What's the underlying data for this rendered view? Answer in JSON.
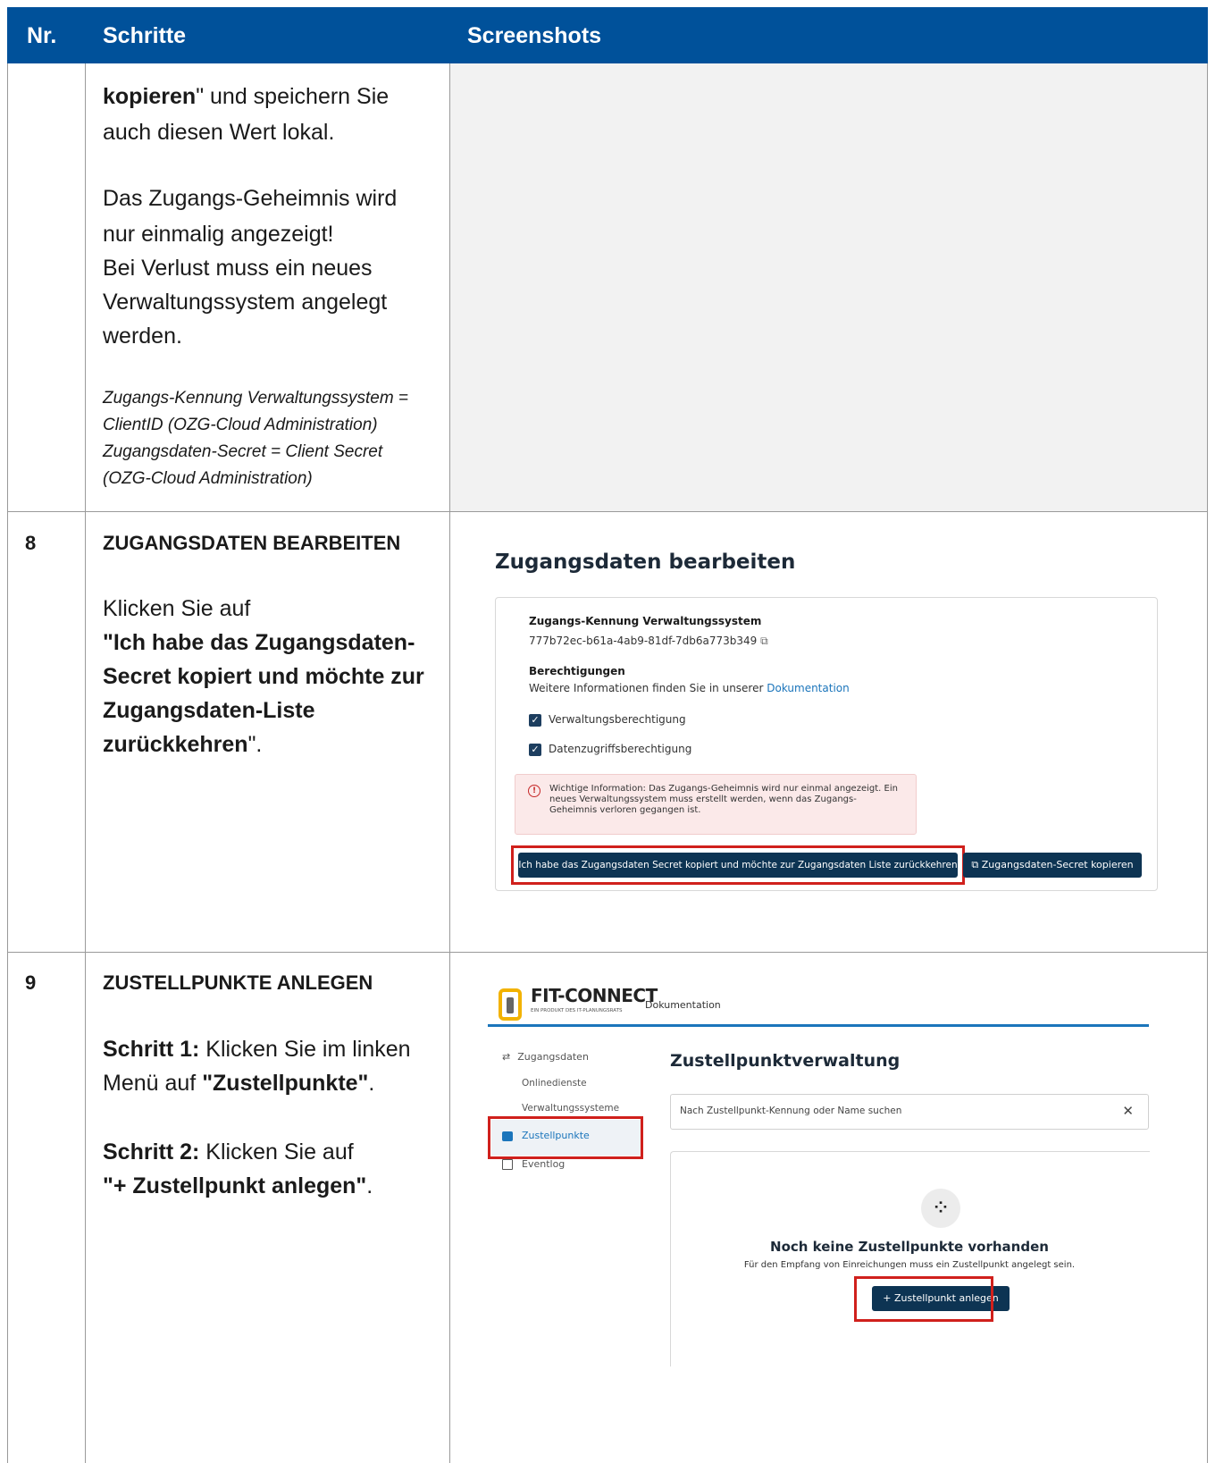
{
  "header": {
    "nr": "Nr.",
    "schritte": "Schritte",
    "screenshots": "Screenshots"
  },
  "row_cont": {
    "line1_bold": "kopieren",
    "line1_rest": "\" und speichern Sie",
    "line2": "auch diesen Wert lokal.",
    "para2": [
      "Das Zugangs-Geheimnis wird",
      "nur einmalig angezeigt!",
      "Bei Verlust muss ein neues",
      "Verwaltungssystem angelegt",
      "werden."
    ],
    "notes": [
      "Zugangs-Kennung Verwaltungssystem =",
      "ClientID (OZG-Cloud Administration)",
      "Zugangsdaten-Secret = Client Secret",
      "(OZG-Cloud Administration)"
    ]
  },
  "row8": {
    "nr": "8",
    "title": "ZUGANGSDATEN BEARBEITEN",
    "intro": "Klicken Sie auf",
    "bold_lines": [
      "\"Ich habe das Zugangsdaten-",
      "Secret kopiert und möchte zur",
      "Zugangsdaten-Liste"
    ],
    "last_bold": "zurückkehren",
    "last_rest": "\".",
    "shot": {
      "heading": "Zugangsdaten bearbeiten",
      "id_label": "Zugangs-Kennung Verwaltungssystem",
      "id_value": "777b72ec-b61a-4ab9-81df-7db6a773b349",
      "perm_label": "Berechtigungen",
      "perm_text": "Weitere Informationen finden Sie in unserer ",
      "perm_link": "Dokumentation",
      "check1": "Verwaltungsberechtigung",
      "check2": "Datenzugriffsberechtigung",
      "alert": [
        "Wichtige Information: Das Zugangs-Geheimnis wird nur einmal angezeigt. Ein",
        "neues Verwaltungssystem muss erstellt werden, wenn das Zugangs-",
        "Geheimnis verloren gegangen ist."
      ],
      "btn_back": "Ich habe das Zugangsdaten Secret kopiert und möchte zur Zugangsdaten Liste zurückkehren",
      "btn_copy": "Zugangsdaten-Secret kopieren",
      "colors": {
        "dark_button": "#0d3453",
        "link": "#1b75bb",
        "alert_bg": "#fbe9e9",
        "highlight": "#d0201c"
      }
    }
  },
  "row9": {
    "nr": "9",
    "title": "ZUSTELLPUNKTE ANLEGEN",
    "s1_bold": "Schritt 1:",
    "s1_text": " Klicken Sie im linken",
    "s1_line2": "Menü auf ",
    "s1_bold2": "\"Zustellpunkte\"",
    "s1_end": ".",
    "s2_bold": "Schritt 2:",
    "s2_text": " Klicken Sie auf",
    "s2_bold2": "\"+ Zustellpunkt anlegen\"",
    "s2_end": ".",
    "shot": {
      "logo_main": "FIT-CONNECT",
      "logo_sub": "EIN PRODUKT DES IT-PLANUNGSRATS",
      "top_nav": "Dokumentation",
      "nav": [
        "Zugangsdaten",
        "Onlinedienste",
        "Verwaltungssysteme",
        "Zustellpunkte",
        "Eventlog"
      ],
      "heading": "Zustellpunktverwaltung",
      "search_placeholder": "Nach Zustellpunkt-Kennung oder Name suchen",
      "empty_title": "Noch keine Zustellpunkte vorhanden",
      "empty_text": "Für den Empfang von Einreichungen muss ein Zustellpunkt angelegt sein.",
      "btn_add": "Zustellpunkt anlegen"
    }
  }
}
